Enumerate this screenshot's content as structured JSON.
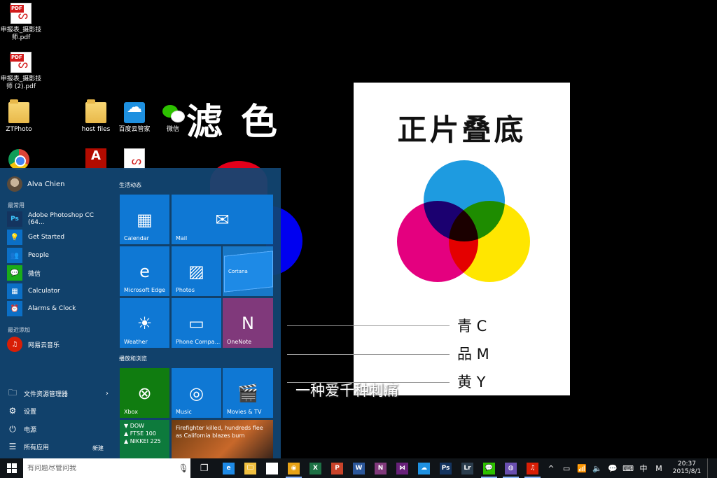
{
  "desktop": {
    "icons": [
      {
        "label": "申报表_摄影技师.pdf",
        "kind": "pdf-icon"
      },
      {
        "label": "申报表_摄影技师 (2).pdf",
        "kind": "pdf-icon"
      },
      {
        "label": "ZTPhoto",
        "kind": "folder-icon"
      },
      {
        "label": "host files",
        "kind": "folder-icon"
      },
      {
        "label": "百度云管家",
        "kind": "baidu-cloud-icon"
      },
      {
        "label": "微信",
        "kind": "wechat-icon"
      },
      {
        "label": "",
        "kind": "chrome-icon"
      },
      {
        "label": "",
        "kind": "adobe-icon"
      },
      {
        "label": "",
        "kind": "acrobat-icon"
      }
    ],
    "pdf_tag": "PDF",
    "calligraphy": "滤色",
    "poster": {
      "title": "正片叠底",
      "legend": [
        "青 C",
        "品 M",
        "黄 Y"
      ],
      "colors": {
        "cyan": "#1e9be0",
        "magenta": "#e4007f",
        "yellow": "#ffe600"
      }
    },
    "subtitle": "一种爱千种刺痛"
  },
  "start_menu": {
    "user_name": "Alva Chien",
    "most_used_label": "最常用",
    "most_used": [
      {
        "label": "Adobe Photoshop CC (64...",
        "icon": "Ps"
      },
      {
        "label": "Get Started",
        "icon": "💡"
      },
      {
        "label": "People",
        "icon": "👥"
      },
      {
        "label": "微信",
        "icon": "💬"
      },
      {
        "label": "Calculator",
        "icon": "▦"
      },
      {
        "label": "Alarms & Clock",
        "icon": "⏰"
      }
    ],
    "recently_added_label": "最近添加",
    "recently_added": [
      {
        "label": "网易云音乐",
        "icon": "♫"
      }
    ],
    "bottom_items": [
      {
        "label": "文件资源管理器",
        "icon": "🗀",
        "has_chevron": true
      },
      {
        "label": "设置",
        "icon": "⚙",
        "has_chevron": false
      },
      {
        "label": "电源",
        "icon": "⏻",
        "has_chevron": false
      },
      {
        "label": "所有应用",
        "icon": "☰",
        "has_chevron": false
      }
    ],
    "chevron": "›",
    "new_badge": "新建",
    "group1_label": "生活动态",
    "group2_label": "播放和浏览",
    "tiles": {
      "calendar": "Calendar",
      "mail": "Mail",
      "edge": "Microsoft Edge",
      "photos": "Photos",
      "cortana": "Cortana",
      "weather": "Weather",
      "phone": "Phone Compa...",
      "onenote": "OneNote",
      "xbox": "Xbox",
      "music": "Music",
      "movies": "Movies & TV",
      "money_lines": [
        "▼ DOW",
        "▲ FTSE 100",
        "▲ NIKKEI 225"
      ],
      "news": "Firefighter killed, hundreds flee as California blazes burn"
    }
  },
  "taskbar": {
    "search_placeholder": "有问题尽管问我",
    "apps": [
      {
        "name": "edge",
        "glyph": "e",
        "color": "#1e8ae6",
        "active": false
      },
      {
        "name": "file-explorer",
        "glyph": "🗀",
        "color": "#f0c040",
        "active": false
      },
      {
        "name": "store",
        "glyph": "🛍",
        "color": "#ffffff",
        "active": false
      },
      {
        "name": "chrome",
        "glyph": "◉",
        "color": "#e8a317",
        "active": true
      },
      {
        "name": "excel",
        "glyph": "X",
        "color": "#1d7044",
        "active": false
      },
      {
        "name": "powerpoint",
        "glyph": "P",
        "color": "#c8432a",
        "active": false
      },
      {
        "name": "word",
        "glyph": "W",
        "color": "#2b579a",
        "active": false
      },
      {
        "name": "onenote",
        "glyph": "N",
        "color": "#80397b",
        "active": false
      },
      {
        "name": "visual-studio",
        "glyph": "⋈",
        "color": "#68217a",
        "active": false
      },
      {
        "name": "baidu-cloud",
        "glyph": "☁",
        "color": "#1e90e0",
        "active": false
      },
      {
        "name": "photoshop",
        "glyph": "Ps",
        "color": "#14345f",
        "active": false
      },
      {
        "name": "lightroom",
        "glyph": "Lr",
        "color": "#2b3d4d",
        "active": false
      },
      {
        "name": "wechat",
        "glyph": "💬",
        "color": "#2dc100",
        "active": true
      },
      {
        "name": "media-player",
        "glyph": "◍",
        "color": "#6a4fb0",
        "active": true
      },
      {
        "name": "netease-music",
        "glyph": "♫",
        "color": "#d81e06",
        "active": true
      }
    ],
    "tray": [
      "^",
      "▭",
      "📶",
      "🔈",
      "💬",
      "⌨",
      "中",
      "M"
    ],
    "time": "20:37",
    "date": "2015/8/1"
  }
}
